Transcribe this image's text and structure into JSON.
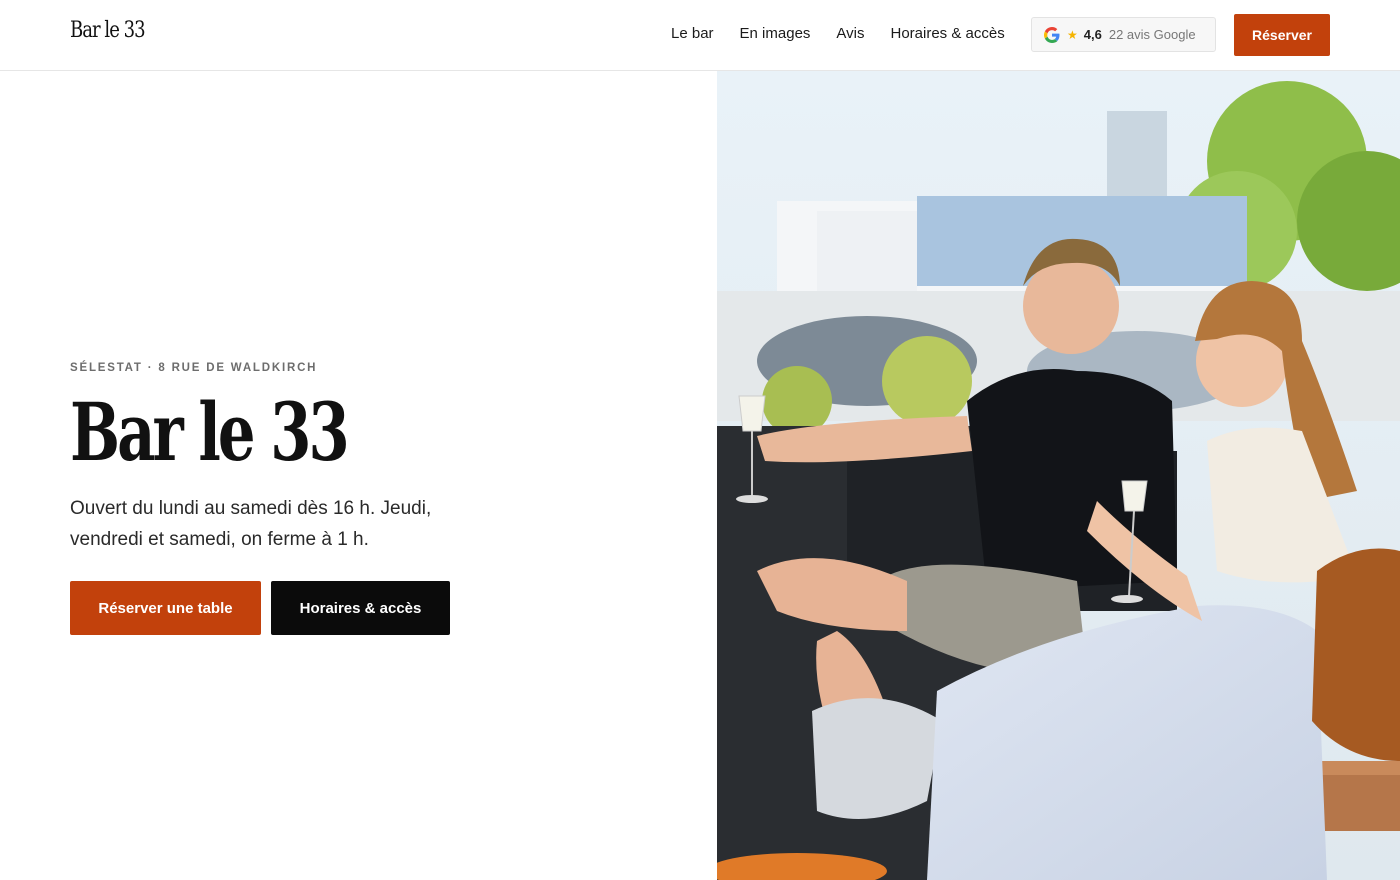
{
  "header": {
    "logo": "Bar le 33",
    "nav": [
      "Le bar",
      "En images",
      "Avis",
      "Horaires & accès"
    ],
    "google": {
      "rating": "4,6",
      "reviews": "22 avis Google",
      "icon": "google-icon",
      "star_icon": "star-icon"
    },
    "reserve_label": "Réserver"
  },
  "hero": {
    "eyebrow": "SÉLESTAT · 8 RUE DE WALDKIRCH",
    "title": "Bar le 33",
    "description": "Ouvert du lundi au samedi dès 16 h. Jeudi, vendredi et samedi, on ferme à 1 h.",
    "primary_cta": "Réserver une table",
    "secondary_cta": "Horaires & accès"
  },
  "colors": {
    "accent": "#c2410c",
    "dark": "#0b0b0b",
    "star": "#f5b400"
  }
}
